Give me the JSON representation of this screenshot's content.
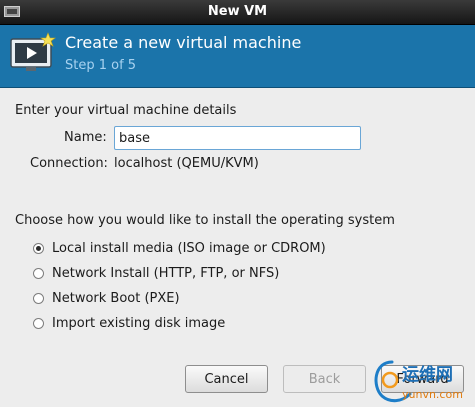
{
  "window": {
    "title": "New VM"
  },
  "header": {
    "title": "Create a new virtual machine",
    "step": "Step 1 of 5"
  },
  "details": {
    "heading": "Enter your virtual machine details",
    "name_label": "Name:",
    "name_value": "base",
    "connection_label": "Connection:",
    "connection_value": "localhost (QEMU/KVM)"
  },
  "install": {
    "heading": "Choose how you would like to install the operating system",
    "selected_index": 0,
    "options": [
      {
        "label": "Local install media (ISO image or CDROM)",
        "checked": true
      },
      {
        "label": "Network Install (HTTP, FTP, or NFS)",
        "checked": false
      },
      {
        "label": "Network Boot (PXE)",
        "checked": false
      },
      {
        "label": "Import existing disk image",
        "checked": false
      }
    ]
  },
  "buttons": {
    "cancel": "Cancel",
    "back": "Back",
    "forward": "Forward"
  },
  "watermark": {
    "text": "运维网",
    "url": "yunvn.com"
  }
}
